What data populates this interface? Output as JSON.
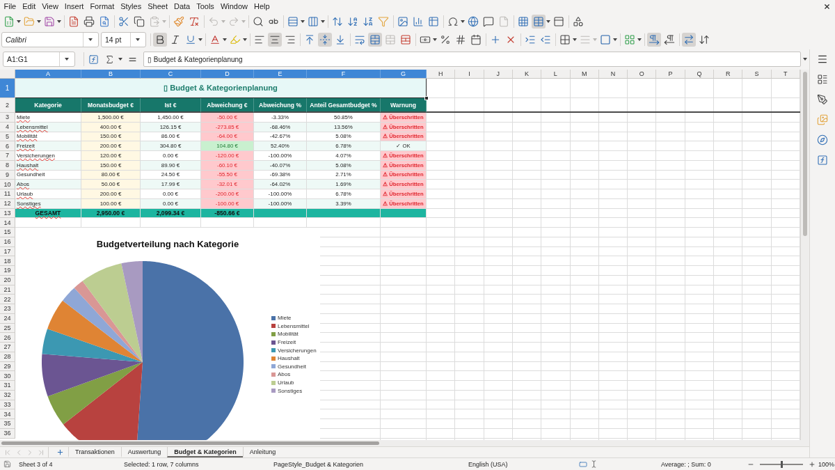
{
  "menu_bar": [
    "File",
    "Edit",
    "View",
    "Insert",
    "Format",
    "Styles",
    "Sheet",
    "Data",
    "Tools",
    "Window",
    "Help"
  ],
  "standard_toolbar": [
    {
      "pressed": false,
      "disabled": false
    },
    {
      "pressed": false,
      "disabled": false
    },
    {
      "pressed": false,
      "disabled": false
    },
    {
      "pressed": false,
      "disabled": false
    },
    {
      "pressed": false,
      "disabled": false
    },
    {
      "pressed": false,
      "disabled": false
    },
    {
      "pressed": false,
      "disabled": false
    },
    {
      "pressed": false,
      "disabled": false
    },
    {
      "pressed": false,
      "disabled": true
    },
    {
      "pressed": false,
      "disabled": false
    },
    {
      "pressed": false,
      "disabled": false
    },
    {
      "pressed": false,
      "disabled": true
    },
    {
      "pressed": false,
      "disabled": true
    },
    {
      "pressed": false,
      "disabled": false
    },
    {
      "pressed": false,
      "disabled": false
    },
    {
      "pressed": false,
      "disabled": false
    },
    {
      "pressed": false,
      "disabled": false
    },
    {
      "pressed": false,
      "disabled": false
    },
    {
      "pressed": false,
      "disabled": false
    },
    {
      "pressed": false,
      "disabled": false
    },
    {
      "pressed": false,
      "disabled": false
    },
    {
      "pressed": false,
      "disabled": false
    },
    {
      "pressed": false,
      "disabled": false
    },
    {
      "pressed": false,
      "disabled": false
    },
    {
      "pressed": false,
      "disabled": false
    },
    {
      "pressed": false,
      "disabled": false
    },
    {
      "pressed": false,
      "disabled": false
    },
    {
      "pressed": false,
      "disabled": true
    },
    {
      "pressed": false,
      "disabled": false
    },
    {
      "pressed": true,
      "disabled": false
    },
    {
      "pressed": false,
      "disabled": false
    },
    {
      "pressed": false,
      "disabled": false
    }
  ],
  "formatting_toolbar": {
    "font_name": "Calibri",
    "font_size": "14 pt",
    "buttons": [
      {
        "pressed": true,
        "disabled": false
      },
      {
        "pressed": false,
        "disabled": false
      },
      {
        "pressed": false,
        "disabled": false
      },
      {
        "pressed": false,
        "disabled": false
      },
      {
        "pressed": false,
        "disabled": false
      },
      {
        "pressed": false,
        "disabled": false
      },
      {
        "pressed": true,
        "disabled": false
      },
      {
        "pressed": false,
        "disabled": false
      },
      {
        "pressed": false,
        "disabled": false
      },
      {
        "pressed": true,
        "disabled": false
      },
      {
        "pressed": false,
        "disabled": false
      },
      {
        "pressed": false,
        "disabled": false
      },
      {
        "pressed": true,
        "disabled": false
      },
      {
        "pressed": false,
        "disabled": true
      },
      {
        "pressed": false,
        "disabled": false
      },
      {
        "pressed": false,
        "disabled": false
      },
      {
        "pressed": false,
        "disabled": false
      },
      {
        "pressed": false,
        "disabled": false
      },
      {
        "pressed": false,
        "disabled": false
      },
      {
        "pressed": false,
        "disabled": false
      },
      {
        "pressed": false,
        "disabled": false
      },
      {
        "pressed": false,
        "disabled": false
      },
      {
        "pressed": false,
        "disabled": false
      },
      {
        "pressed": false,
        "disabled": false
      },
      {
        "pressed": false,
        "disabled": true
      },
      {
        "pressed": false,
        "disabled": false
      },
      {
        "pressed": false,
        "disabled": false
      },
      {
        "pressed": true,
        "disabled": false
      },
      {
        "pressed": false,
        "disabled": false
      },
      {
        "pressed": true,
        "disabled": false
      },
      {
        "pressed": false,
        "disabled": false
      }
    ]
  },
  "formula_bar": {
    "name_box": "A1:G1",
    "content": "▯ Budget & Kategorienplanung"
  },
  "sheet": {
    "columns": [
      {
        "label": "A",
        "selected": true
      },
      {
        "label": "B",
        "selected": true
      },
      {
        "label": "C",
        "selected": true
      },
      {
        "label": "D",
        "selected": true
      },
      {
        "label": "E",
        "selected": true
      },
      {
        "label": "F",
        "selected": true
      },
      {
        "label": "G",
        "selected": true
      },
      {
        "label": "H",
        "selected": false
      },
      {
        "label": "I",
        "selected": false
      },
      {
        "label": "J",
        "selected": false
      },
      {
        "label": "K",
        "selected": false
      },
      {
        "label": "L",
        "selected": false
      },
      {
        "label": "M",
        "selected": false
      },
      {
        "label": "N",
        "selected": false
      },
      {
        "label": "O",
        "selected": false
      },
      {
        "label": "P",
        "selected": false
      },
      {
        "label": "Q",
        "selected": false
      },
      {
        "label": "R",
        "selected": false
      },
      {
        "label": "S",
        "selected": false
      },
      {
        "label": "T",
        "selected": false
      }
    ],
    "row_headers": [
      {
        "label": "1",
        "selected": true
      },
      {
        "label": "2",
        "selected": false
      },
      {
        "label": "3",
        "selected": false
      },
      {
        "label": "4",
        "selected": false
      },
      {
        "label": "5",
        "selected": false
      },
      {
        "label": "6",
        "selected": false
      },
      {
        "label": "7",
        "selected": false
      },
      {
        "label": "8",
        "selected": false
      },
      {
        "label": "9",
        "selected": false
      },
      {
        "label": "10",
        "selected": false
      },
      {
        "label": "11",
        "selected": false
      },
      {
        "label": "12",
        "selected": false
      },
      {
        "label": "13",
        "selected": false
      },
      {
        "label": "14",
        "selected": false
      },
      {
        "label": "15",
        "selected": false
      },
      {
        "label": "16",
        "selected": false
      },
      {
        "label": "17",
        "selected": false
      },
      {
        "label": "18",
        "selected": false
      },
      {
        "label": "19",
        "selected": false
      },
      {
        "label": "20",
        "selected": false
      },
      {
        "label": "21",
        "selected": false
      },
      {
        "label": "22",
        "selected": false
      },
      {
        "label": "23",
        "selected": false
      },
      {
        "label": "24",
        "selected": false
      },
      {
        "label": "25",
        "selected": false
      },
      {
        "label": "26",
        "selected": false
      },
      {
        "label": "27",
        "selected": false
      },
      {
        "label": "28",
        "selected": false
      },
      {
        "label": "29",
        "selected": false
      },
      {
        "label": "30",
        "selected": false
      },
      {
        "label": "31",
        "selected": false
      },
      {
        "label": "32",
        "selected": false
      },
      {
        "label": "33",
        "selected": false
      },
      {
        "label": "34",
        "selected": false
      },
      {
        "label": "35",
        "selected": false
      },
      {
        "label": "36",
        "selected": false
      }
    ],
    "title": {
      "text": "▯ Budget & Kategorienplanung",
      "selected": true
    },
    "table": {
      "columns": [
        "Kategorie",
        "Monatsbudget €",
        "Ist €",
        "Abweichung €",
        "Abweichung %",
        "Anteil Gesamtbudget %",
        "Warnung"
      ],
      "rows": [
        {
          "cells": [
            "Miete",
            "1,500.00 €",
            "1,450.00 €",
            "-50.00 €",
            "-3.33%",
            "50.85%",
            "⚠ Überschritten"
          ],
          "exceeded": true,
          "spell_error": true
        },
        {
          "cells": [
            "Lebensmittel",
            "400.00 €",
            "126.15 €",
            "-273.85 €",
            "-68.46%",
            "13.56%",
            "⚠ Überschritten"
          ],
          "exceeded": true,
          "spell_error": true
        },
        {
          "cells": [
            "Mobilität",
            "150.00 €",
            "86.00 €",
            "-64.00 €",
            "-42.67%",
            "5.08%",
            "⚠ Überschritten"
          ],
          "exceeded": true,
          "spell_error": true
        },
        {
          "cells": [
            "Freizeit",
            "200.00 €",
            "304.80 €",
            "104.80 €",
            "52.40%",
            "6.78%",
            "✓ OK"
          ],
          "exceeded": false,
          "spell_error": true
        },
        {
          "cells": [
            "Versicherungen",
            "120.00 €",
            "0.00 €",
            "-120.00 €",
            "-100.00%",
            "4.07%",
            "⚠ Überschritten"
          ],
          "exceeded": true,
          "spell_error": true
        },
        {
          "cells": [
            "Haushalt",
            "150.00 €",
            "89.90 €",
            "-60.10 €",
            "-40.07%",
            "5.08%",
            "⚠ Überschritten"
          ],
          "exceeded": true,
          "spell_error": true
        },
        {
          "cells": [
            "Gesundheit",
            "80.00 €",
            "24.50 €",
            "-55.50 €",
            "-69.38%",
            "2.71%",
            "⚠ Überschritten"
          ],
          "exceeded": true,
          "spell_error": false
        },
        {
          "cells": [
            "Abos",
            "50.00 €",
            "17.99 €",
            "-32.01 €",
            "-64.02%",
            "1.69%",
            "⚠ Überschritten"
          ],
          "exceeded": true,
          "spell_error": true
        },
        {
          "cells": [
            "Urlaub",
            "200.00 €",
            "0.00 €",
            "-200.00 €",
            "-100.00%",
            "6.78%",
            "⚠ Überschritten"
          ],
          "exceeded": true,
          "spell_error": true
        },
        {
          "cells": [
            "Sonstiges",
            "100.00 €",
            "0.00 €",
            "-100.00 €",
            "-100.00%",
            "3.39%",
            "⚠ Überschritten"
          ],
          "exceeded": true,
          "spell_error": true
        }
      ],
      "total": {
        "cells": [
          "GESAMT",
          "2,950.00 €",
          "2,099.34 €",
          "-850.66 €"
        ],
        "spell_error": true
      }
    },
    "chart": {
      "chart_data": {
        "type": "pie",
        "title": "Budgetverteilung nach Kategorie",
        "categories": [
          "Miete",
          "Lebensmittel",
          "Mobilität",
          "Freizeit",
          "Versicherungen",
          "Haushalt",
          "Gesundheit",
          "Abos",
          "Urlaub",
          "Sonstiges"
        ],
        "values": [
          50.85,
          13.56,
          5.08,
          6.78,
          4.07,
          5.08,
          2.71,
          1.69,
          6.78,
          3.39
        ],
        "legend": "right"
      }
    }
  },
  "sheet_navigation": [
    {
      "disabled": true
    },
    {
      "disabled": true
    },
    {
      "disabled": true
    },
    {
      "disabled": true
    }
  ],
  "sheet_tabs": [
    {
      "label": "Transaktionen",
      "selected": false
    },
    {
      "label": "Auswertung",
      "selected": false
    },
    {
      "label": "Budget & Kategorien",
      "selected": true
    },
    {
      "label": "Anleitung",
      "selected": false
    }
  ],
  "status_bar": {
    "sheet": "Sheet 3 of 4",
    "selection": "Selected: 1 row, 7 columns",
    "page_style": "PageStyle_Budget & Kategorien",
    "language": "English (USA)",
    "summary": "Average: ; Sum: 0",
    "zoom_slider": {
      "level": 0.5
    },
    "zoom": "100%"
  }
}
